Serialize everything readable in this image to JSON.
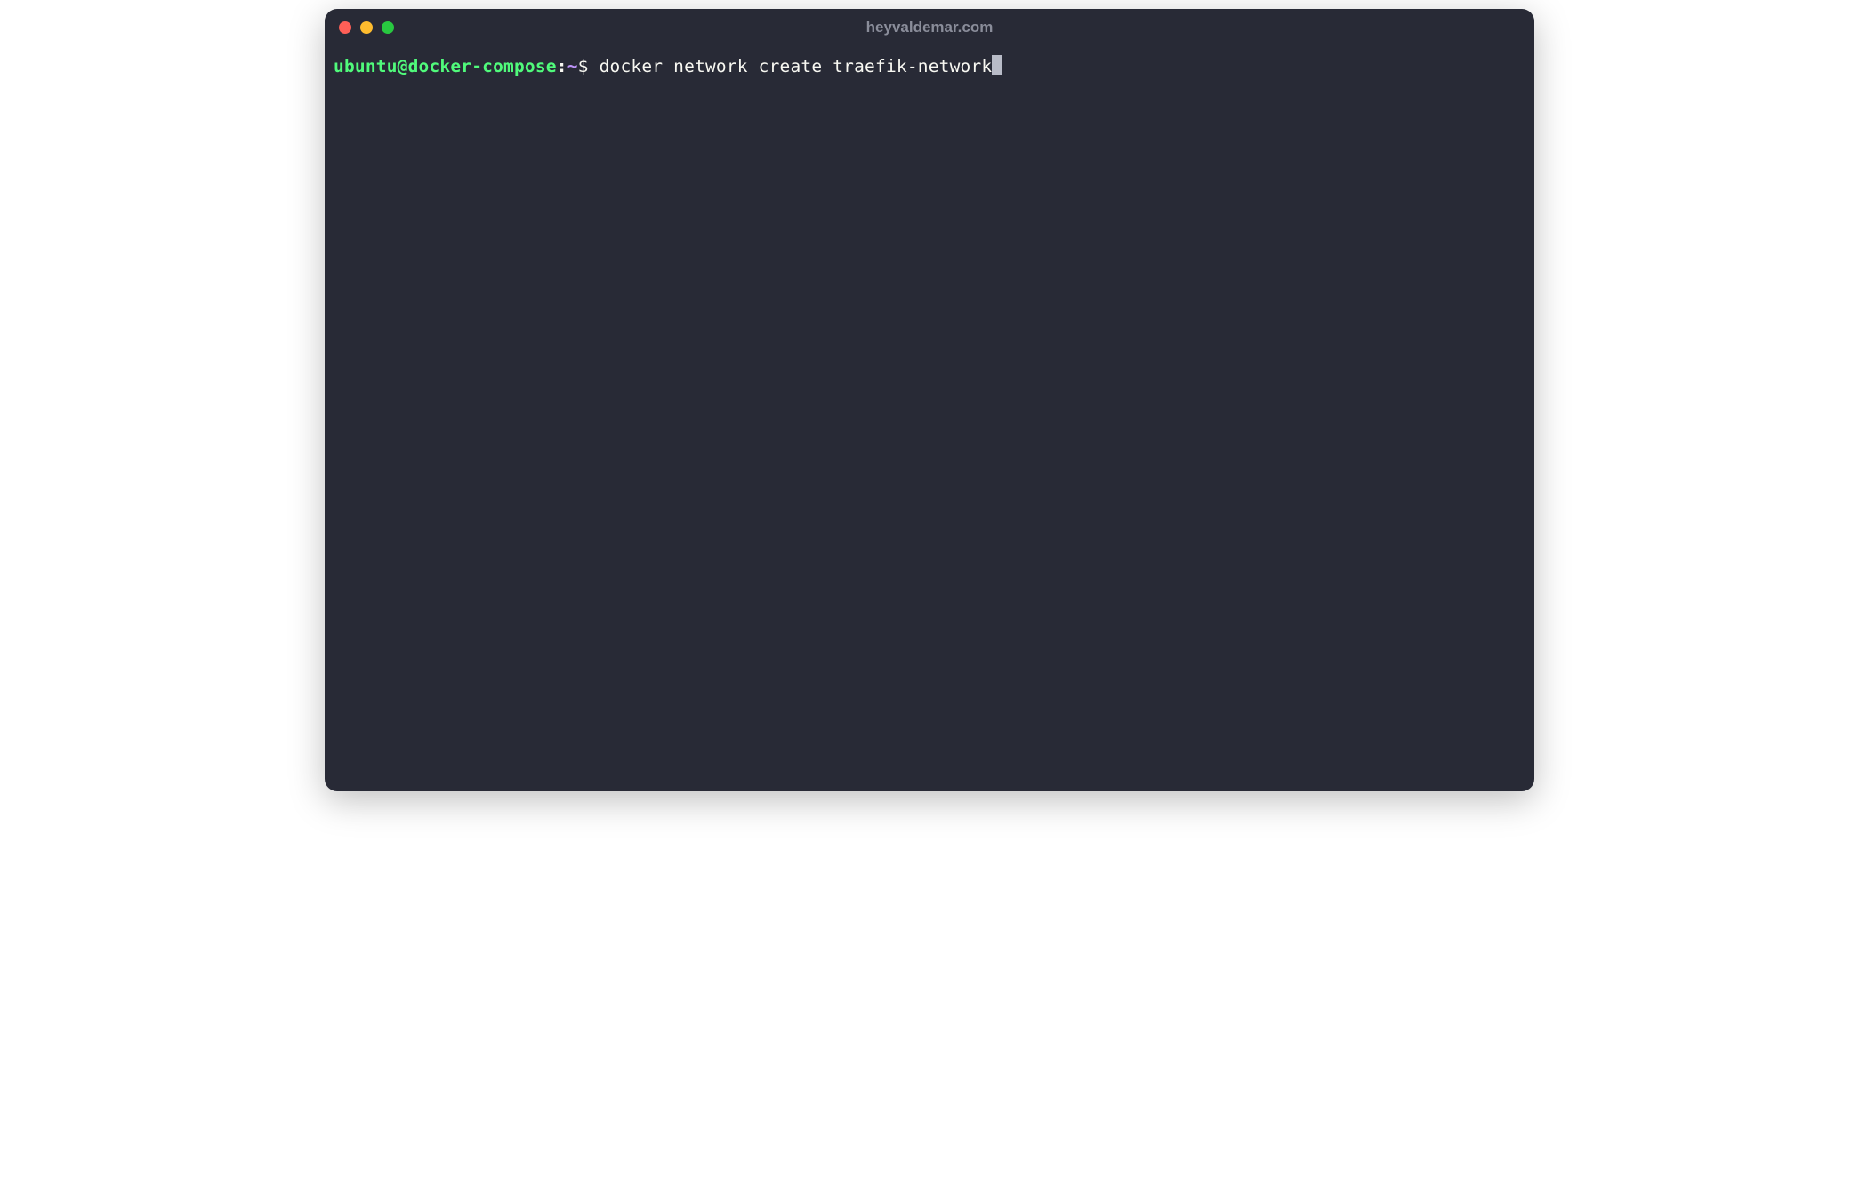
{
  "window": {
    "title": "heyvaldemar.com"
  },
  "prompt": {
    "user_host": "ubuntu@docker-compose",
    "separator": ":",
    "cwd": "~",
    "symbol": "$"
  },
  "command": "docker network create traefik-network",
  "colors": {
    "bg": "#282a36",
    "fg": "#f8f8f2",
    "green": "#50fa7b",
    "purple": "#bd93f9",
    "title": "#8a8d9a",
    "close": "#ff5f57",
    "minimize": "#febc2e",
    "maximize": "#28c840"
  }
}
